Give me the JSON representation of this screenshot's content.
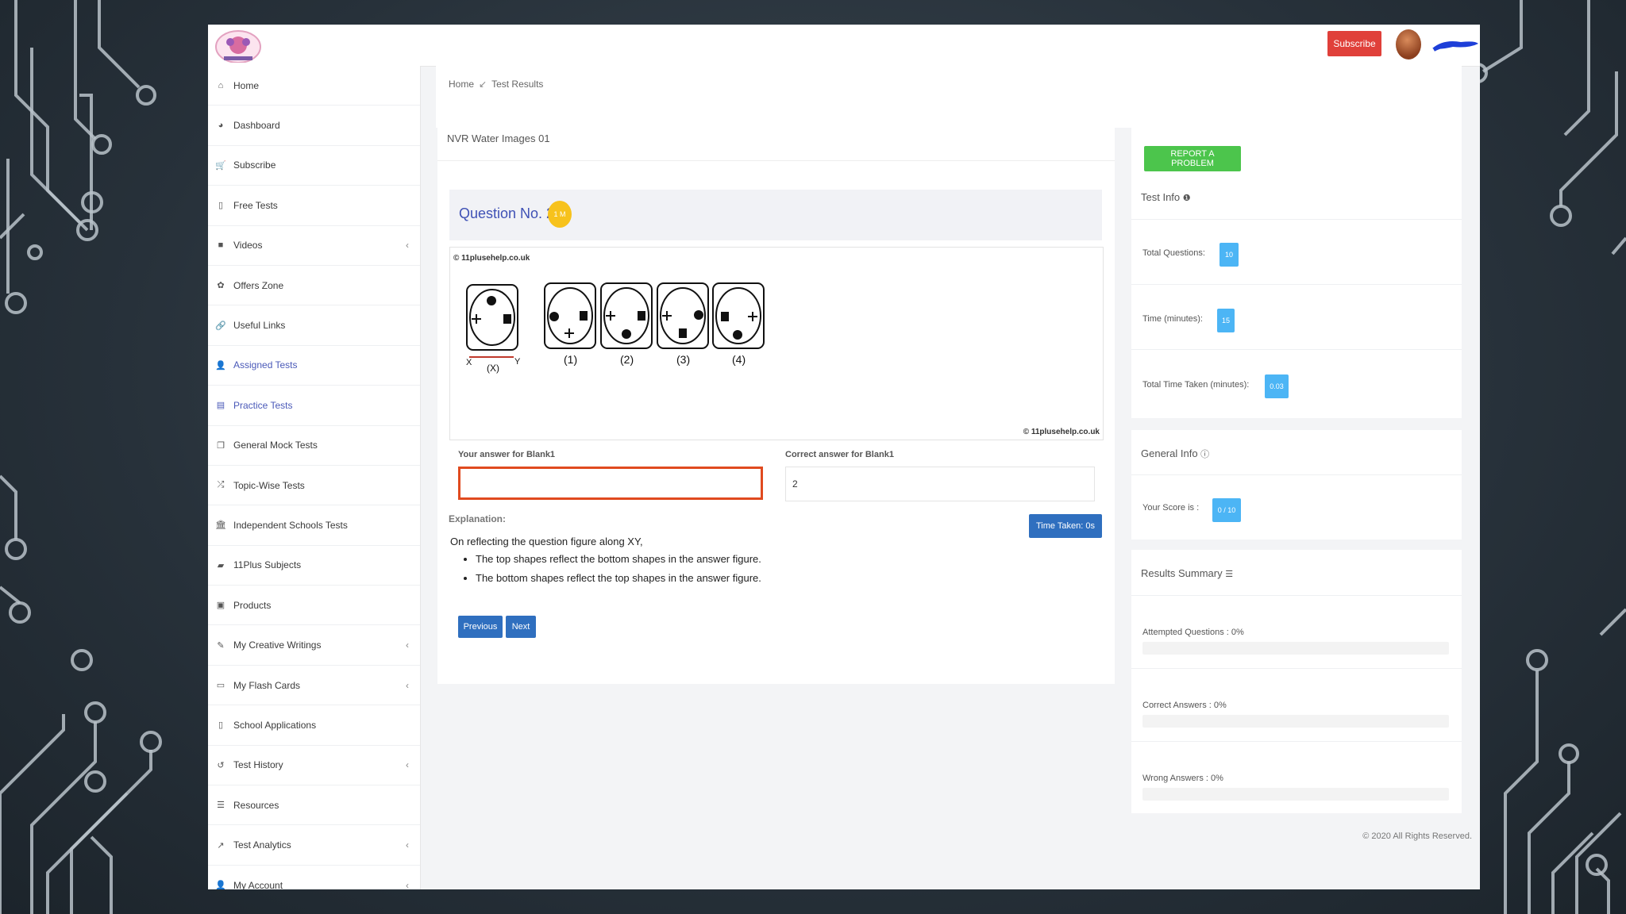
{
  "header": {
    "subscribe_label": "Subscribe",
    "logo_alt": "11Plus Help"
  },
  "sidebar": {
    "items": [
      {
        "label": "Home",
        "icon": "home-icon",
        "chevron": false
      },
      {
        "label": "Dashboard",
        "icon": "dashboard-icon",
        "chevron": false
      },
      {
        "label": "Subscribe",
        "icon": "cart-icon",
        "chevron": false
      },
      {
        "label": "Free Tests",
        "icon": "file-icon",
        "chevron": false
      },
      {
        "label": "Videos",
        "icon": "video-icon",
        "chevron": true
      },
      {
        "label": "Offers Zone",
        "icon": "gift-icon",
        "chevron": false
      },
      {
        "label": "Useful Links",
        "icon": "link-icon",
        "chevron": false
      },
      {
        "label": "Assigned Tests",
        "icon": "user-plus-icon",
        "chevron": false,
        "active": true
      },
      {
        "label": "Practice Tests",
        "icon": "document-icon",
        "chevron": false,
        "active": true
      },
      {
        "label": "General Mock Tests",
        "icon": "copy-icon",
        "chevron": false
      },
      {
        "label": "Topic-Wise Tests",
        "icon": "shuffle-icon",
        "chevron": false
      },
      {
        "label": "Independent Schools Tests",
        "icon": "bank-icon",
        "chevron": false
      },
      {
        "label": "11Plus Subjects",
        "icon": "book-icon",
        "chevron": false
      },
      {
        "label": "Products",
        "icon": "bag-icon",
        "chevron": false
      },
      {
        "label": "My Creative Writings",
        "icon": "pencil-icon",
        "chevron": true
      },
      {
        "label": "My Flash Cards",
        "icon": "card-icon",
        "chevron": true
      },
      {
        "label": "School Applications",
        "icon": "clipboard-icon",
        "chevron": false
      },
      {
        "label": "Test History",
        "icon": "history-icon",
        "chevron": true
      },
      {
        "label": "Resources",
        "icon": "list-icon",
        "chevron": false
      },
      {
        "label": "Test Analytics",
        "icon": "chart-icon",
        "chevron": true
      },
      {
        "label": "My Account",
        "icon": "user-icon",
        "chevron": true
      }
    ]
  },
  "breadcrumb": {
    "home": "Home",
    "current": "Test Results"
  },
  "test": {
    "title": "NVR Water Images 01",
    "question_title": "Question No. 2",
    "question_badge": "1 M",
    "copyright": "© 11plusehelp.co.uk",
    "fig_x": "X",
    "fig_y": "Y",
    "fig_question_label": "(X)",
    "option_labels": [
      "(1)",
      "(2)",
      "(3)",
      "(4)"
    ],
    "your_answer_label": "Your answer for Blank1",
    "your_answer_value": "",
    "correct_answer_label": "Correct answer for Blank1",
    "correct_answer_value": "2",
    "explanation_label": "Explanation:",
    "time_taken_label": "Time Taken: 0s",
    "explanation_intro": "On reflecting the question figure along XY,",
    "explanation_points": [
      "The top shapes reflect the bottom shapes in the answer figure.",
      "The bottom shapes reflect the top shapes in the answer figure."
    ],
    "previous_label": "Previous",
    "next_label": "Next"
  },
  "side": {
    "report_label": "REPORT A PROBLEM",
    "test_info_title": "Test Info",
    "total_questions_label": "Total Questions:",
    "total_questions_value": "10",
    "time_label": "Time (minutes):",
    "time_value": "15",
    "time_taken_label": "Total Time Taken (minutes):",
    "time_taken_value": "0.03",
    "general_info_title": "General Info",
    "score_label": "Your Score is :",
    "score_value": "0 / 10",
    "results_title": "Results Summary",
    "attempted_label": "Attempted Questions : 0%",
    "attempted_pct": 0,
    "correct_label": "Correct Answers : 0%",
    "correct_pct": 0,
    "wrong_label": "Wrong Answers : 0%",
    "wrong_pct": 0
  },
  "footer": {
    "text": "© 2020 All Rights Reserved."
  },
  "colors": {
    "accent": "#3f51b5",
    "primary_button": "#2f6fbf",
    "subscribe": "#e0403a",
    "report": "#4cc54c",
    "badge": "#4cb5f5",
    "question_badge": "#f7c21c"
  }
}
